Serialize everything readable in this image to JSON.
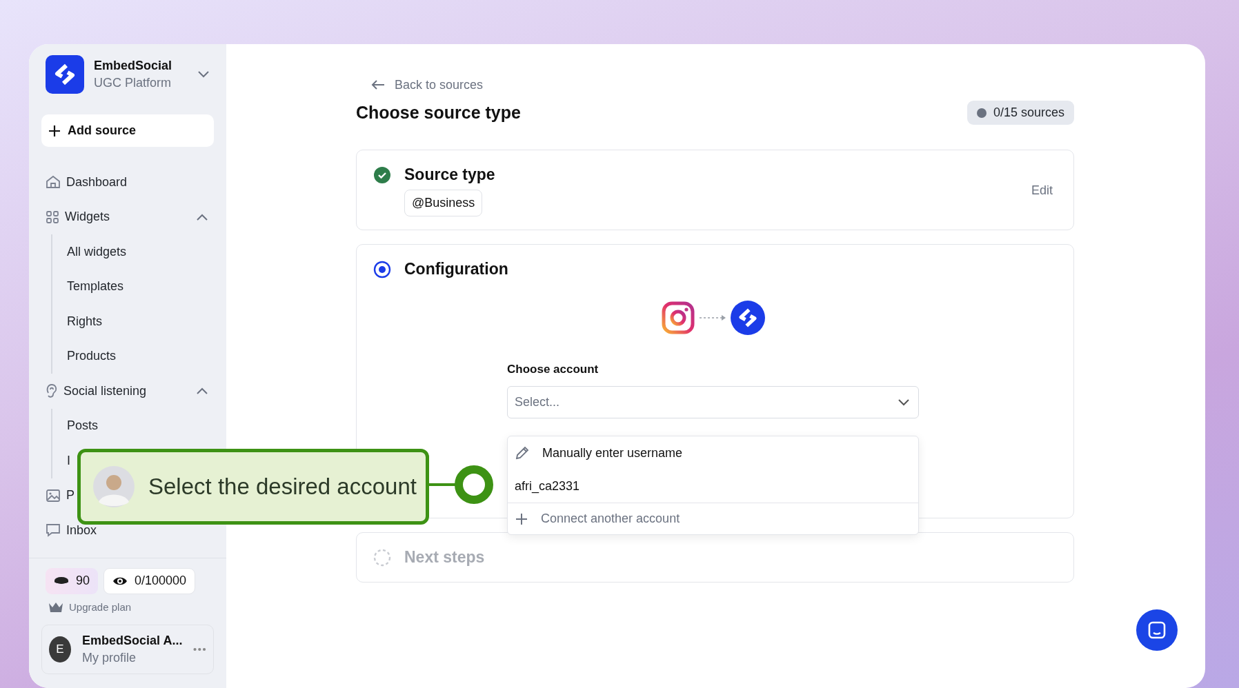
{
  "brand": {
    "name": "EmbedSocial",
    "subtitle": "UGC Platform"
  },
  "add_source": "Add source",
  "nav": [
    {
      "label": "Dashboard",
      "kind": "home"
    },
    {
      "label": "Widgets",
      "kind": "grid",
      "expanded": true,
      "children": [
        {
          "label": "All widgets"
        },
        {
          "label": "Templates"
        },
        {
          "label": "Rights"
        },
        {
          "label": "Products"
        }
      ]
    },
    {
      "label": "Social listening",
      "kind": "ear",
      "expanded": true,
      "children": [
        {
          "label": "Posts"
        },
        {
          "label": "I"
        }
      ]
    },
    {
      "label": "P",
      "kind": "image"
    },
    {
      "label": "Inbox",
      "kind": "chat"
    }
  ],
  "credits": "90",
  "views": "0/100000",
  "upgrade": "Upgrade plan",
  "profile": {
    "initial": "E",
    "name": "EmbedSocial A...",
    "subtitle": "My profile"
  },
  "back": "Back to sources",
  "title": "Choose source type",
  "quota": "0/15 sources",
  "steps": [
    {
      "kind": "done",
      "title": "Source type",
      "tag": "@Business",
      "action": "Edit"
    },
    {
      "kind": "active",
      "title": "Configuration",
      "field_label": "Choose account",
      "placeholder": "Select...",
      "options": [
        {
          "kind": "manual",
          "label": "Manually enter username"
        },
        {
          "kind": "account",
          "label": "afri_ca2331"
        },
        {
          "kind": "connect",
          "label": "Connect another account"
        }
      ]
    },
    {
      "kind": "pending",
      "title": "Next steps"
    }
  ],
  "tooltip": "Select the desired account"
}
